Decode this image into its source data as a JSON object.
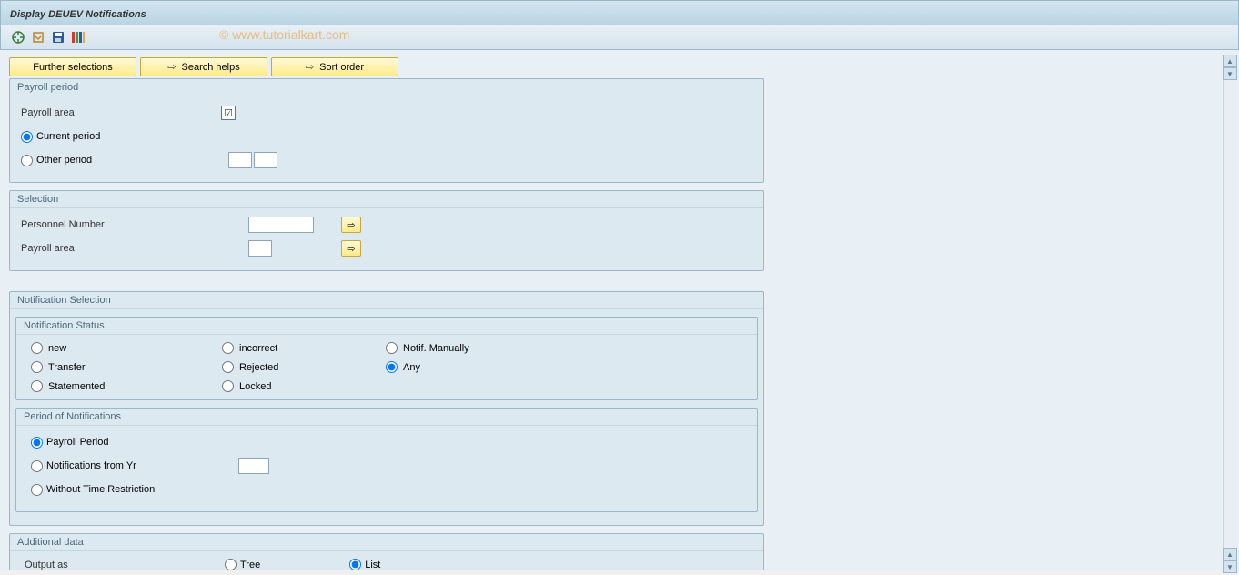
{
  "title": "Display DEUEV Notifications",
  "watermark": "© www.tutorialkart.com",
  "toolbar_buttons": {
    "further_selections": "Further selections",
    "search_helps": "Search helps",
    "sort_order": "Sort order"
  },
  "payroll_period": {
    "title": "Payroll period",
    "payroll_area_label": "Payroll area",
    "current_period": "Current period",
    "other_period": "Other period"
  },
  "selection": {
    "title": "Selection",
    "personnel_number": "Personnel Number",
    "payroll_area": "Payroll area"
  },
  "notification_selection": {
    "title": "Notification Selection",
    "status": {
      "title": "Notification Status",
      "new": "new",
      "incorrect": "incorrect",
      "notif_manually": "Notif. Manually",
      "transfer": "Transfer",
      "rejected": "Rejected",
      "any": "Any",
      "statemented": "Statemented",
      "locked": "Locked"
    },
    "period": {
      "title": "Period of Notifications",
      "payroll_period": "Payroll Period",
      "notifications_from_yr": "Notifications from Yr",
      "without_time_restriction": "Without Time Restriction"
    }
  },
  "additional_data": {
    "title": "Additional data",
    "output_as": "Output as",
    "tree": "Tree",
    "list": "List"
  }
}
